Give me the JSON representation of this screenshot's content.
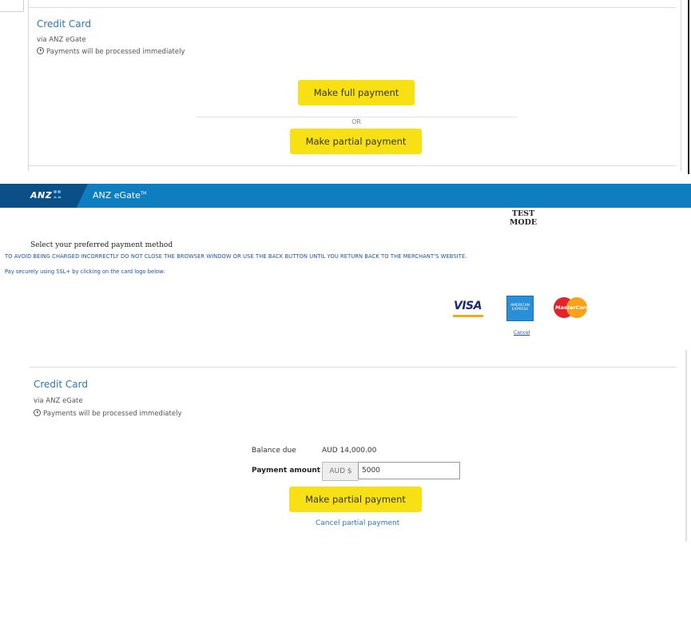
{
  "panel_top": {
    "title": "Credit Card",
    "via": "via ANZ eGate",
    "note": "Payments will be processed immediately",
    "full_payment_button": "Make full payment",
    "or_text": "OR",
    "partial_payment_button": "Make partial payment"
  },
  "egate": {
    "logo": "ANZ",
    "title": "ANZ eGate",
    "trademark": "TM",
    "test_mode_line1": "TEST",
    "test_mode_line2": "MODE",
    "select_method": "Select your preferred payment method",
    "warning": "TO AVOID BEING CHARGED INCORRECTLY DO NOT CLOSE THE BROWSER WINDOW OR USE THE BACK BUTTON UNTIL YOU RETURN BACK TO THE MERCHANT'S WEBSITE.",
    "ssl_note": "Pay securely using SSL+ by clicking on the card logo below:",
    "cards": {
      "visa": "VISA",
      "amex": "AMERICAN EXPRESS",
      "mastercard": "MasterCard"
    },
    "cancel": "Cancel"
  },
  "panel_bottom": {
    "title": "Credit Card",
    "via": "via ANZ eGate",
    "note": "Payments will be processed immediately",
    "balance_label": "Balance due",
    "balance_value": "AUD 14,000.00",
    "amount_label": "Payment amount",
    "currency_prefix": "AUD $",
    "amount_value": "5000",
    "partial_payment_button": "Make partial payment",
    "cancel_partial": "Cancel partial payment"
  },
  "colors": {
    "accent_blue": "#2d77b6",
    "anz_bar": "#0f7ec0",
    "button_yellow": "#f7e013",
    "link_blue": "#1d4f9c"
  }
}
